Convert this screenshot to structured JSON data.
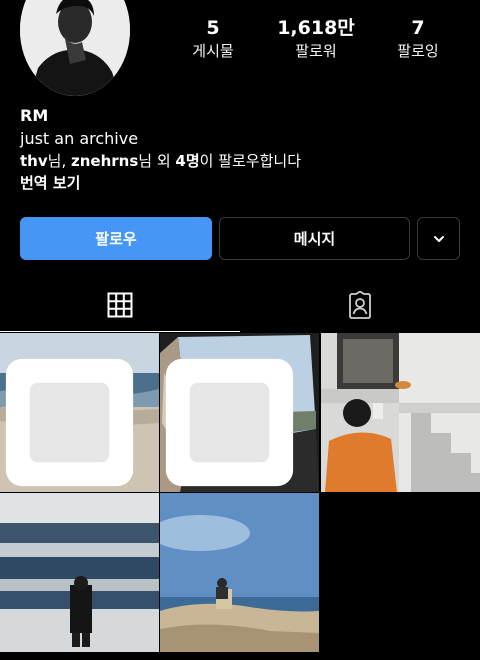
{
  "profile": {
    "name": "RM",
    "bio": "just an archive"
  },
  "stats": [
    {
      "value": "5",
      "label": "게시물"
    },
    {
      "value": "1,618만",
      "label": "팔로워"
    },
    {
      "value": "7",
      "label": "팔로잉"
    }
  ],
  "followed_by": {
    "user1": "thv",
    "sep1": "님, ",
    "user2": "znehrns",
    "sep2": "님 외 ",
    "count": "4명",
    "tail": "이 팔로우합니다"
  },
  "translate_label": "번역 보기",
  "buttons": {
    "follow": "팔로우",
    "message": "메시지"
  },
  "icons": {
    "more": "chevron-down-icon",
    "grid_tab": "grid-icon",
    "tagged_tab": "tagged-person-icon",
    "multi_photo": "multi-photo-icon"
  },
  "colors": {
    "background": "#000000",
    "follow_button": "#4596f5"
  }
}
